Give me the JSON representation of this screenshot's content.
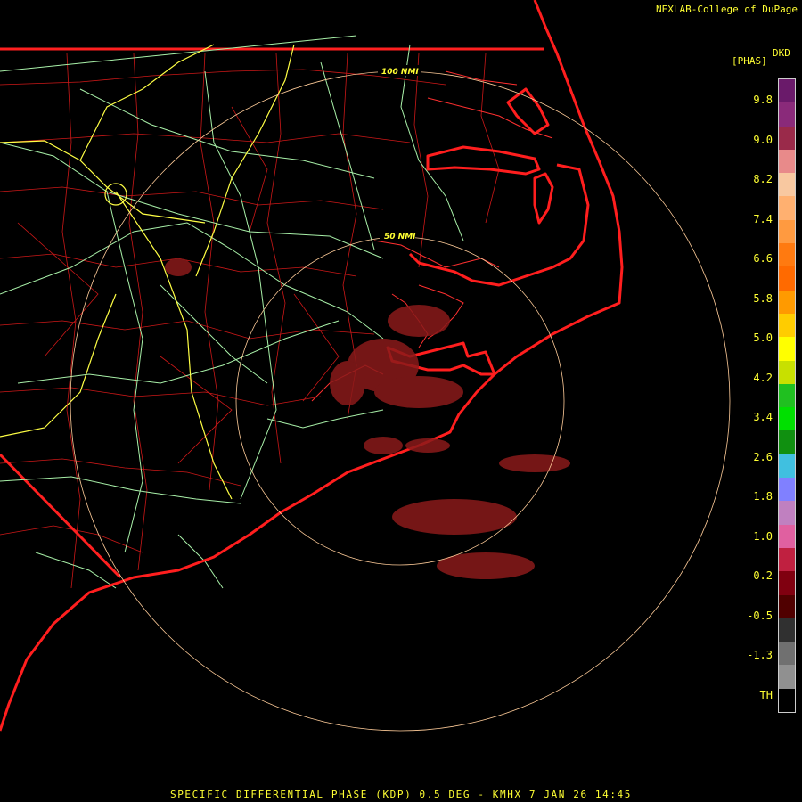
{
  "credit": "NEXLAB-College of DuPage",
  "product_code": "DKD",
  "units": "[PHAS]",
  "footer": "SPECIFIC DIFFERENTIAL PHASE (KDP) 0.5 DEG - KMHX 7 JAN 26 14:45",
  "range_rings": [
    "50 NMI",
    "100 NMI"
  ],
  "legend": {
    "labels": [
      "9.8",
      "9.0",
      "8.2",
      "7.4",
      "6.6",
      "5.8",
      "5.0",
      "4.2",
      "3.4",
      "2.6",
      "1.8",
      "1.0",
      "0.2",
      "-0.5",
      "-1.3",
      "TH"
    ],
    "colors": [
      "#6a1a6a",
      "#8a2a7a",
      "#9a2a4a",
      "#e88a8a",
      "#f8c8a0",
      "#ffb070",
      "#ff9a40",
      "#ff7a10",
      "#ff6a00",
      "#ff9a00",
      "#ffcc00",
      "#ffff00",
      "#c8e000",
      "#20c020",
      "#00e000",
      "#109010",
      "#40c0e0",
      "#8080ff",
      "#c080c0",
      "#e060a0",
      "#c02040",
      "#800010",
      "#500000",
      "#303030",
      "#707070",
      "#909090",
      "#000000"
    ]
  },
  "colors": {
    "coast": "#ff1e1e",
    "counties": "#ff2222",
    "highways": "#aaffaa",
    "interstates": "#ffff55",
    "rings": "#ffcc99",
    "echo": "#8a1a1a"
  }
}
